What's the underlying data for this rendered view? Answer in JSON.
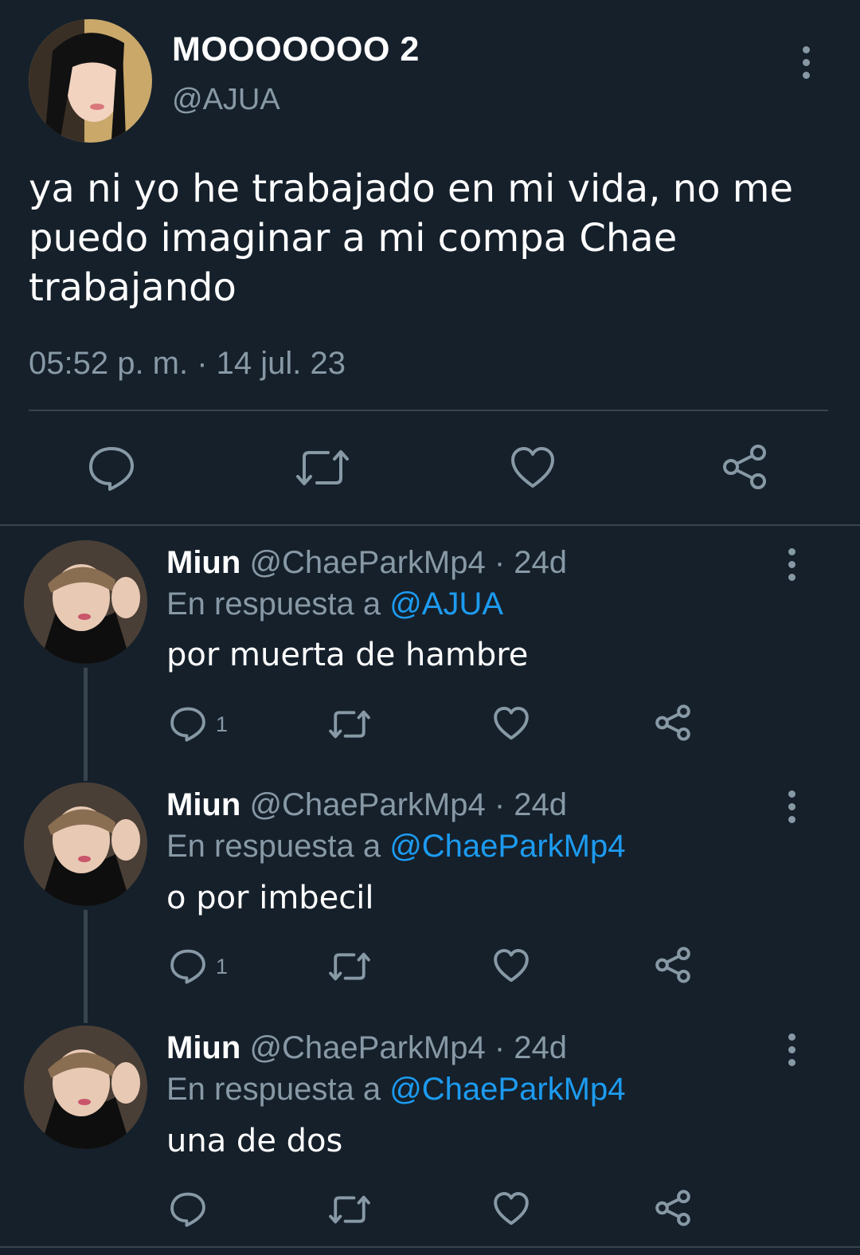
{
  "main_tweet": {
    "display_name": "MOOOOOOO 2",
    "handle": "@AJUA",
    "text_lines": [
      "ya ni yo he trabajado en mi vida, no me",
      "puedo imaginar a mi compa Chae",
      "trabajando"
    ],
    "timestamp": "05:52 p. m. · 14 jul. 23",
    "actions": {
      "reply_icon": "reply-icon",
      "retweet_icon": "retweet-icon",
      "like_icon": "heart-icon",
      "share_icon": "share-icon"
    }
  },
  "replies": [
    {
      "display_name": "Miun",
      "handle_time": "@ChaeParkMp4 · 24d",
      "reply_prefix": "En respuesta a",
      "reply_to": "@AJUA",
      "text": "por muerta de hambre",
      "reply_count": "1"
    },
    {
      "display_name": "Miun",
      "handle_time": "@ChaeParkMp4 · 24d",
      "reply_prefix": "En respuesta a",
      "reply_to": "@ChaeParkMp4",
      "text": "o por imbecil",
      "reply_count": "1"
    },
    {
      "display_name": "Miun",
      "handle_time": "@ChaeParkMp4 · 24d",
      "reply_prefix": "En respuesta a",
      "reply_to": "@ChaeParkMp4",
      "text": "una de dos",
      "reply_count": ""
    }
  ],
  "colors": {
    "background": "#15202b",
    "secondary_text": "#8899a6",
    "link": "#1d9bf0",
    "divider": "#38444d"
  }
}
